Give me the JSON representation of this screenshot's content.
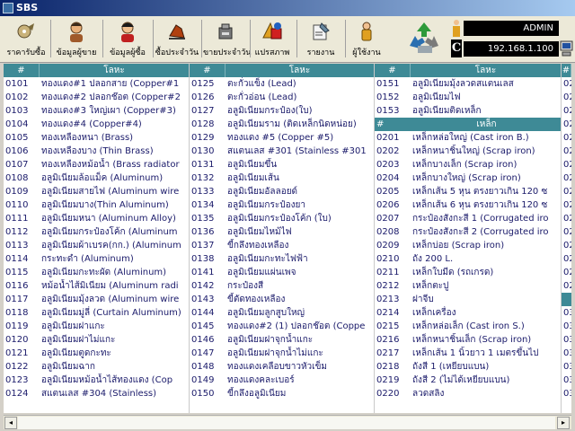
{
  "window": {
    "title": "SBS"
  },
  "toolbar": {
    "buttons": [
      {
        "label": "ราคารับซื้อ",
        "icon": "price-tag-icon"
      },
      {
        "label": "ข้อมูลผู้ขาย",
        "icon": "seller-person-icon"
      },
      {
        "label": "ข้อมูลผู้ซื้อ",
        "icon": "buyer-person-icon"
      },
      {
        "label": "ซื้อประจำวัน",
        "icon": "daily-buy-icon"
      },
      {
        "label": "ขายประจำวัน",
        "icon": "daily-sell-icon"
      },
      {
        "label": "แปรสภาพ",
        "icon": "convert-shapes-icon"
      },
      {
        "label": "รายงาน",
        "icon": "report-icon"
      },
      {
        "label": "ผู้ใช้งาน",
        "icon": "user-icon"
      }
    ]
  },
  "status": {
    "user": "ADMIN",
    "ip": "192.168.1.100",
    "conn_letter": "C"
  },
  "grid": {
    "columns": [
      {
        "header_code": "#",
        "header_name": "โลหะ",
        "rows": [
          {
            "code": "0101",
            "name": "ทองแดง#1 ปลอกสาย (Copper#1"
          },
          {
            "code": "0102",
            "name": "ทองแดง#2 ปลอกช๊อต (Copper#2"
          },
          {
            "code": "0103",
            "name": "ทองแดง#3 ใหญ่เผา (Copper#3)"
          },
          {
            "code": "0104",
            "name": "ทองแดง#4 (Copper#4)"
          },
          {
            "code": "0105",
            "name": "ทองเหลืองหนา (Brass)"
          },
          {
            "code": "0106",
            "name": "ทองเหลืองบาง (Thin Brass)"
          },
          {
            "code": "0107",
            "name": "ทองเหลืองหม้อน้ำ (Brass radiator"
          },
          {
            "code": "0108",
            "name": "อลูมิเนียมล้อแม็ค (Aluminum)"
          },
          {
            "code": "0109",
            "name": "อลูมิเนียมสายไฟ (Aluminum wire"
          },
          {
            "code": "0110",
            "name": "อลูมิเนียมบาง(Thin Aluminum)"
          },
          {
            "code": "0111",
            "name": "อลูมิเนียมหนา (Aluminum Alloy)"
          },
          {
            "code": "0112",
            "name": "อลูมิเนียมกระป๋องโค้ก (Aluminum"
          },
          {
            "code": "0113",
            "name": "อลูมิเนียมผ้าเบรค(กก.) (Aluminum"
          },
          {
            "code": "0114",
            "name": "กระทะดำ (Aluminum)"
          },
          {
            "code": "0115",
            "name": "อลูมิเนียมกะทะผัด (Aluminum)"
          },
          {
            "code": "0116",
            "name": "หม้อน้ำไส้มิเนียม (Aluminum radi"
          },
          {
            "code": "0117",
            "name": "อลูมิเนียมมุ้งลวด (Aluminum wire"
          },
          {
            "code": "0118",
            "name": "อลูมิเนียมมู่ลี่ (Curtain Aluminum)"
          },
          {
            "code": "0119",
            "name": "อลูมิเนียมฝาแกะ"
          },
          {
            "code": "0120",
            "name": "อลูมิเนียมฝาไม่แกะ"
          },
          {
            "code": "0121",
            "name": "อลูมิเนียมตูดกะทะ"
          },
          {
            "code": "0122",
            "name": "อลูมิเนียมฉาก"
          },
          {
            "code": "0123",
            "name": "อลูมิเนียมหม้อน้ำไส้ทองแดง (Cop"
          },
          {
            "code": "0124",
            "name": "สแตนเลส #304 (Stainless)"
          }
        ]
      },
      {
        "header_code": "#",
        "header_name": "โลหะ",
        "rows": [
          {
            "code": "0125",
            "name": "ตะกั่วแข็ง (Lead)"
          },
          {
            "code": "0126",
            "name": "ตะกั่วอ่อน (Lead)"
          },
          {
            "code": "0127",
            "name": "อลูมิเนียมกระป๋อง(ใบ)"
          },
          {
            "code": "0128",
            "name": "อลูมิเนียมราม (ติดเหล็กนิดหน่อย)"
          },
          {
            "code": "0129",
            "name": "ทองแดง #5 (Copper #5)"
          },
          {
            "code": "0130",
            "name": "สแตนเลส #301 (Stainless #301"
          },
          {
            "code": "0131",
            "name": "อลูมิเนียมขึ้น"
          },
          {
            "code": "0132",
            "name": "อลูมิเนียมเส้น"
          },
          {
            "code": "0133",
            "name": "อลูมิเนียมอัลลอยด์"
          },
          {
            "code": "0134",
            "name": "อลูมิเนียมกระป๋องยา"
          },
          {
            "code": "0135",
            "name": "อลูมิเนียมกระป๋องโค้ก (ใบ)"
          },
          {
            "code": "0136",
            "name": "อลูมิเนียมไหม้ไฟ"
          },
          {
            "code": "0137",
            "name": "ขี้กลึงทองเหลือง"
          },
          {
            "code": "0138",
            "name": "อลูมิเนียมกะทะไฟฟ้า"
          },
          {
            "code": "0141",
            "name": "อลูมิเนียมแผ่นเพจ"
          },
          {
            "code": "0142",
            "name": "กระป๋องสี"
          },
          {
            "code": "0143",
            "name": "ขี้ตัดทองเหลือง"
          },
          {
            "code": "0144",
            "name": "อลูมิเนียมลูกสูบใหญ่"
          },
          {
            "code": "0145",
            "name": "ทองแดง#2 (1) ปลอกช๊อต (Coppe"
          },
          {
            "code": "0146",
            "name": "อลูมิเนียมฝาจุกน้ำแกะ"
          },
          {
            "code": "0147",
            "name": "อลูมิเนียมฝาจุกน้ำไม่แกะ"
          },
          {
            "code": "0148",
            "name": "ทองแดงเคลือบขาวหัวเข็ม"
          },
          {
            "code": "0149",
            "name": "ทองแดงคละเบอร์"
          },
          {
            "code": "0150",
            "name": "ขี้กลึงอลูมิเนียม"
          }
        ]
      },
      {
        "header_code": "#",
        "header_name": "โลหะ",
        "rows": [
          {
            "code": "0151",
            "name": "อลูมิเนียมมุ้งลวดสแตนเลส"
          },
          {
            "code": "0152",
            "name": "อลูมิเนียมไฟ"
          },
          {
            "code": "0153",
            "name": "อลูมิเนียมติดเหล็ก"
          },
          {
            "code": "#",
            "name": "เหล็ก",
            "highlight": true
          },
          {
            "code": "0201",
            "name": "เหล็กหล่อใหญ่ (Cast iron B.)"
          },
          {
            "code": "0202",
            "name": "เหล็กหนาชิ้นใหญ่ (Scrap iron)"
          },
          {
            "code": "0203",
            "name": "เหล็กบางเล็ก (Scrap iron)"
          },
          {
            "code": "0204",
            "name": "เหล็กบางใหญ่ (Scrap iron)"
          },
          {
            "code": "0205",
            "name": "เหล็กเส้น 5 หุน ตรงยาวเกิน 120 ซ"
          },
          {
            "code": "0206",
            "name": "เหล็กเส้น 6 หุน ตรงยาวเกิน 120 ซ"
          },
          {
            "code": "0207",
            "name": "กระป๋องสังกะสี 1 (Corrugated iro"
          },
          {
            "code": "0208",
            "name": "กระป๋องสังกะสี 2 (Corrugated iro"
          },
          {
            "code": "0209",
            "name": "เหล็กบ่อย (Scrap iron)"
          },
          {
            "code": "0210",
            "name": "ถัง 200 L."
          },
          {
            "code": "0211",
            "name": "เหล็กใบมีด (รถเกรด)"
          },
          {
            "code": "0212",
            "name": "เหล็กตะปู"
          },
          {
            "code": "0213",
            "name": "ฝาจีบ"
          },
          {
            "code": "0214",
            "name": "เหล็กเครื่อง"
          },
          {
            "code": "0215",
            "name": "เหล็กหล่อเล็ก (Cast iron S.)"
          },
          {
            "code": "0216",
            "name": "เหล็กหนาชิ้นเล็ก (Scrap iron)"
          },
          {
            "code": "0217",
            "name": "เหล็กเส้น 1 นิ้วยาว 1 เมตรขึ้นไป"
          },
          {
            "code": "0218",
            "name": "ถังสี 1 (เหยียบแบน)"
          },
          {
            "code": "0219",
            "name": "ถังสี 2 (ไม่ได้เหยียบแบน)"
          },
          {
            "code": "0220",
            "name": "ลวดสลิง"
          }
        ]
      },
      {
        "header_code": "#",
        "rows": [
          {
            "code": "02"
          },
          {
            "code": "02"
          },
          {
            "code": "02"
          },
          {
            "code": "02"
          },
          {
            "code": "02"
          },
          {
            "code": "02"
          },
          {
            "code": "02"
          },
          {
            "code": "02"
          },
          {
            "code": "02"
          },
          {
            "code": "02"
          },
          {
            "code": "02"
          },
          {
            "code": "02"
          },
          {
            "code": "02"
          },
          {
            "code": "02"
          },
          {
            "code": "02"
          },
          {
            "code": "02"
          },
          {
            "code": "",
            "highlight": true
          },
          {
            "code": "03"
          },
          {
            "code": "03"
          },
          {
            "code": "03"
          },
          {
            "code": "03"
          },
          {
            "code": "03"
          },
          {
            "code": "03"
          },
          {
            "code": "03"
          }
        ]
      }
    ]
  },
  "scrollbar": {
    "left_arrow": "◂",
    "right_arrow": "▸"
  },
  "colors": {
    "header_bg": "#3e8a96",
    "text": "#1a1a6a",
    "titlebar": "#0a246a"
  }
}
